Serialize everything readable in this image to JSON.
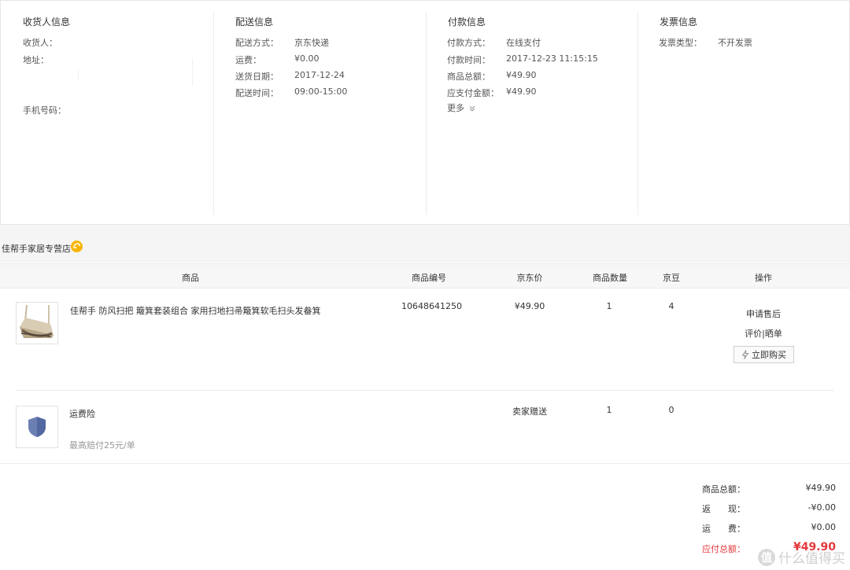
{
  "consignee": {
    "title": "收货人信息",
    "name_label": "收货人：",
    "address_label": "地址：",
    "phone_label": "手机号码："
  },
  "delivery": {
    "title": "配送信息",
    "rows": [
      {
        "label": "配送方式：",
        "value": "京东快递"
      },
      {
        "label": "运费：",
        "value": "¥0.00"
      },
      {
        "label": "送货日期：",
        "value": "2017-12-24"
      },
      {
        "label": "配送时间：",
        "value": "09:00-15:00"
      }
    ]
  },
  "payment": {
    "title": "付款信息",
    "rows": [
      {
        "label": "付款方式：",
        "value": "在线支付"
      },
      {
        "label": "付款时间：",
        "value": "2017-12-23 11:15:15"
      },
      {
        "label": "商品总额：",
        "value": "¥49.90"
      },
      {
        "label": "应支付金额：",
        "value": "¥49.90"
      }
    ],
    "more_label": "更多"
  },
  "invoice": {
    "title": "发票信息",
    "type_label": "发票类型：",
    "type_value": "不开发票"
  },
  "store": {
    "name": "佳帮手家居专营店"
  },
  "table": {
    "headers": [
      "商品",
      "商品编号",
      "京东价",
      "商品数量",
      "京豆",
      "操作"
    ],
    "items": [
      {
        "name": "佳帮手 防风扫把 簸箕套装组合 家用扫地扫帚簸箕软毛扫头发畚箕",
        "sku": "10648641250",
        "price": "¥49.90",
        "qty": "1",
        "beans": "4",
        "ops": [
          "申请售后",
          "评价|晒单"
        ],
        "buy_label": "立即购买"
      },
      {
        "name": "运费险",
        "sub": "最高赔付25元/单",
        "price": "卖家赠送",
        "qty": "1",
        "beans": "0"
      }
    ]
  },
  "summary": {
    "rows": [
      {
        "label": "商品总额：",
        "value": "¥49.90"
      },
      {
        "label": "返　　现：",
        "value": "-¥0.00"
      },
      {
        "label": "运　　费：",
        "value": "¥0.00"
      }
    ],
    "pay_label": "应付总额：",
    "pay_value": "¥49.90"
  },
  "watermark": {
    "icon_text": "值",
    "text": "什么值得买"
  },
  "colors": {
    "accent_red": "#e4393c",
    "store_badge": "#f8b500",
    "shield": "#6b7fb3"
  }
}
